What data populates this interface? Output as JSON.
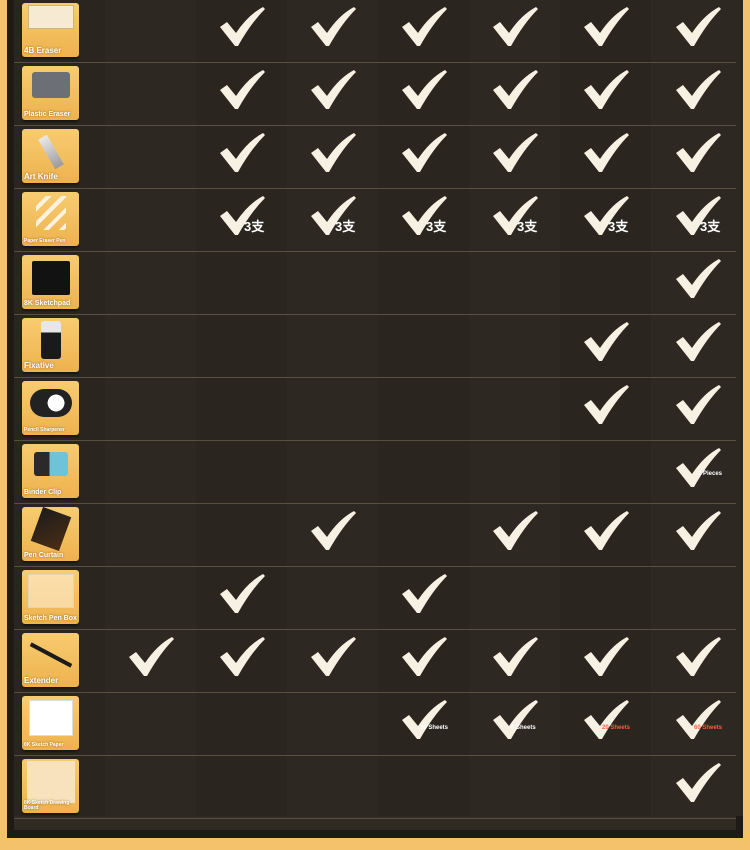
{
  "colors": {
    "background": "#f3c26a",
    "panel": "#2f2a22",
    "check": "#f7f1e4",
    "thumb": "#f2bd5c"
  },
  "rows": [
    {
      "name": "4B Eraser",
      "icon": "eraser-4b-icon",
      "checks": [
        false,
        true,
        true,
        true,
        true,
        true,
        true
      ],
      "notes": [
        "",
        "",
        "",
        "",
        "",
        "",
        ""
      ]
    },
    {
      "name": "Plastic Eraser",
      "icon": "plastic-eraser-icon",
      "checks": [
        false,
        true,
        true,
        true,
        true,
        true,
        true
      ],
      "notes": [
        "",
        "",
        "",
        "",
        "",
        "",
        ""
      ]
    },
    {
      "name": "Art Knife",
      "icon": "art-knife-icon",
      "checks": [
        false,
        true,
        true,
        true,
        true,
        true,
        true
      ],
      "notes": [
        "",
        "",
        "",
        "",
        "",
        "",
        ""
      ]
    },
    {
      "name": "Paper Eraser Pen",
      "icon": "paper-eraser-pen-icon",
      "checks": [
        false,
        true,
        true,
        true,
        true,
        true,
        true
      ],
      "notes": [
        "",
        "3支",
        "3支",
        "3支",
        "3支",
        "3支",
        "3支"
      ]
    },
    {
      "name": "8K Sketchpad",
      "icon": "sketchpad-icon",
      "checks": [
        false,
        false,
        false,
        false,
        false,
        false,
        true
      ],
      "notes": [
        "",
        "",
        "",
        "",
        "",
        "",
        ""
      ]
    },
    {
      "name": "Fixative",
      "icon": "fixative-icon",
      "checks": [
        false,
        false,
        false,
        false,
        false,
        true,
        true
      ],
      "notes": [
        "",
        "",
        "",
        "",
        "",
        "",
        ""
      ]
    },
    {
      "name": "Pencil Sharpener",
      "icon": "pencil-sharpener-icon",
      "checks": [
        false,
        false,
        false,
        false,
        false,
        true,
        true
      ],
      "notes": [
        "",
        "",
        "",
        "",
        "",
        "",
        ""
      ]
    },
    {
      "name": "Binder Clip",
      "icon": "binder-clip-icon",
      "checks": [
        false,
        false,
        false,
        false,
        false,
        false,
        true
      ],
      "notes": [
        "",
        "",
        "",
        "",
        "",
        "",
        "2 Pieces"
      ]
    },
    {
      "name": "Pen Curtain",
      "icon": "pen-curtain-icon",
      "checks": [
        false,
        false,
        true,
        false,
        true,
        true,
        true
      ],
      "notes": [
        "",
        "",
        "",
        "",
        "",
        "",
        ""
      ]
    },
    {
      "name": "Sketch Pen Box",
      "icon": "pen-box-icon",
      "checks": [
        false,
        true,
        false,
        true,
        false,
        false,
        false
      ],
      "notes": [
        "",
        "",
        "",
        "",
        "",
        "",
        ""
      ]
    },
    {
      "name": "Extender",
      "icon": "extender-icon",
      "checks": [
        true,
        true,
        true,
        true,
        true,
        true,
        true
      ],
      "notes": [
        "",
        "",
        "",
        "",
        "",
        "",
        ""
      ]
    },
    {
      "name": "8K Sketch Paper",
      "icon": "sketch-paper-icon",
      "checks": [
        false,
        false,
        false,
        true,
        true,
        true,
        true
      ],
      "notes": [
        "",
        "",
        "",
        "20 Sheets",
        "0 Sheets",
        "20 Sheets",
        "60 Sheets"
      ]
    },
    {
      "name": "8K Sketch Drawing Board",
      "icon": "drawing-board-icon",
      "checks": [
        false,
        false,
        false,
        false,
        false,
        false,
        true
      ],
      "notes": [
        "",
        "",
        "",
        "",
        "",
        "",
        ""
      ]
    }
  ]
}
